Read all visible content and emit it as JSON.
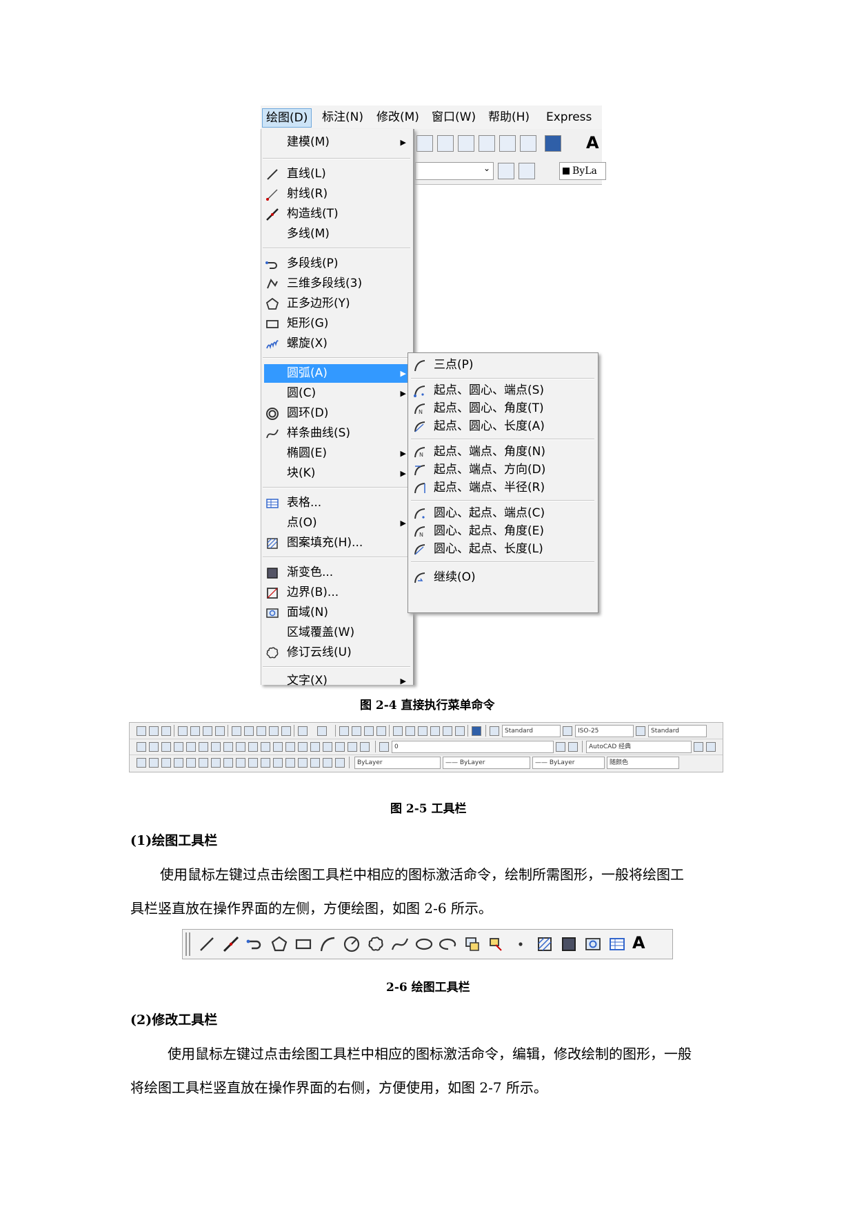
{
  "fig24": {
    "menubar": [
      {
        "label": "绘图(D)",
        "active": true
      },
      {
        "label": "标注(N)",
        "active": false
      },
      {
        "label": "修改(M)",
        "active": false
      },
      {
        "label": "窗口(W)",
        "active": false
      },
      {
        "label": "帮助(H)",
        "active": false
      },
      {
        "label": "Express",
        "active": false
      }
    ],
    "toolbar_bylayer": "ByLa",
    "menu": [
      {
        "label": "建模(M)",
        "arrow": true,
        "icon": ""
      },
      {
        "label": "直线(L)",
        "arrow": false,
        "icon": "line-icon"
      },
      {
        "label": "射线(R)",
        "arrow": false,
        "icon": "ray-icon"
      },
      {
        "label": "构造线(T)",
        "arrow": false,
        "icon": "xline-icon"
      },
      {
        "label": "多线(M)",
        "arrow": false,
        "icon": ""
      },
      {
        "label": "多段线(P)",
        "arrow": false,
        "icon": "polyline-icon"
      },
      {
        "label": "三维多段线(3)",
        "arrow": false,
        "icon": "3dpolyline-icon"
      },
      {
        "label": "正多边形(Y)",
        "arrow": false,
        "icon": "polygon-icon"
      },
      {
        "label": "矩形(G)",
        "arrow": false,
        "icon": "rectangle-icon"
      },
      {
        "label": "螺旋(X)",
        "arrow": false,
        "icon": "helix-icon"
      },
      {
        "label": "圆弧(A)",
        "arrow": true,
        "icon": ""
      },
      {
        "label": "圆(C)",
        "arrow": true,
        "icon": ""
      },
      {
        "label": "圆环(D)",
        "arrow": false,
        "icon": "donut-icon"
      },
      {
        "label": "样条曲线(S)",
        "arrow": false,
        "icon": "spline-icon"
      },
      {
        "label": "椭圆(E)",
        "arrow": true,
        "icon": ""
      },
      {
        "label": "块(K)",
        "arrow": true,
        "icon": ""
      },
      {
        "label": "表格...",
        "arrow": false,
        "icon": "table-icon"
      },
      {
        "label": "点(O)",
        "arrow": true,
        "icon": ""
      },
      {
        "label": "图案填充(H)...",
        "arrow": false,
        "icon": "hatch-icon"
      },
      {
        "label": "渐变色...",
        "arrow": false,
        "icon": "gradient-icon"
      },
      {
        "label": "边界(B)...",
        "arrow": false,
        "icon": "boundary-icon"
      },
      {
        "label": "面域(N)",
        "arrow": false,
        "icon": "region-icon"
      },
      {
        "label": "区域覆盖(W)",
        "arrow": false,
        "icon": ""
      },
      {
        "label": "修订云线(U)",
        "arrow": false,
        "icon": "revcloud-icon"
      },
      {
        "label": "文字(X)",
        "arrow": true,
        "icon": ""
      }
    ],
    "submenu": [
      {
        "label": "三点(P)",
        "icon": "arc-3point-icon"
      },
      {
        "label": "起点、圆心、端点(S)",
        "icon": "arc-sce-icon"
      },
      {
        "label": "起点、圆心、角度(T)",
        "icon": "arc-sca-icon"
      },
      {
        "label": "起点、圆心、长度(A)",
        "icon": "arc-scl-icon"
      },
      {
        "label": "起点、端点、角度(N)",
        "icon": "arc-sea-icon"
      },
      {
        "label": "起点、端点、方向(D)",
        "icon": "arc-sed-icon"
      },
      {
        "label": "起点、端点、半径(R)",
        "icon": "arc-ser-icon"
      },
      {
        "label": "圆心、起点、端点(C)",
        "icon": "arc-cse-icon"
      },
      {
        "label": "圆心、起点、角度(E)",
        "icon": "arc-csa-icon"
      },
      {
        "label": "圆心、起点、长度(L)",
        "icon": "arc-csl-icon"
      },
      {
        "label": "继续(O)",
        "icon": "arc-continue-icon"
      }
    ],
    "caption": "图 2-4 直接执行菜单命令"
  },
  "fig25": {
    "row1_combos": [
      "Standard",
      "ISO-25",
      "Standard"
    ],
    "row2_combos": [
      "0",
      "AutoCAD 经典"
    ],
    "row3_combos": [
      "ByLayer",
      "—— ByLayer",
      "—— ByLayer",
      "随颜色"
    ],
    "caption": "图 2-5 工具栏"
  },
  "section1": {
    "heading": "(1)绘图工具栏",
    "line1": "使用鼠标左键过点击绘图工具栏中相应的图标激活命令，绘制所需图形，一般将绘图工",
    "line2": "具栏竖直放在操作界面的左侧，方便绘图，如图 2-6 所示。"
  },
  "fig26": {
    "caption": "2-6  绘图工具栏",
    "text_icon": "A"
  },
  "section2": {
    "heading": "(2)修改工具栏",
    "line1": "使用鼠标左键过点击绘图工具栏中相应的图标激活命令，编辑，修改绘制的图形，一般",
    "line2": "将绘图工具栏竖直放在操作界面的右侧，方便使用，如图 2-7 所示。"
  }
}
